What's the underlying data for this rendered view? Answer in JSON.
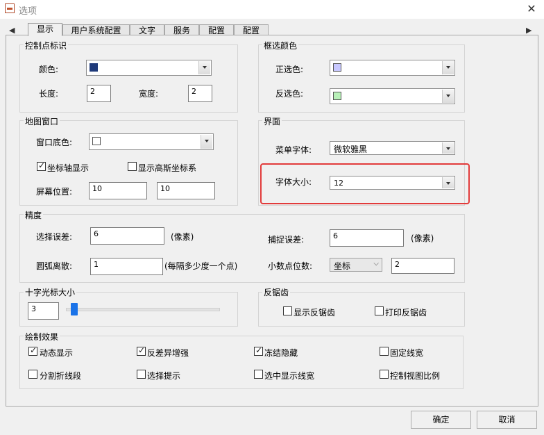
{
  "window": {
    "title": "选项",
    "close_glyph": "✕"
  },
  "tabs": [
    {
      "label": "显示"
    },
    {
      "label": "用户系统配置"
    },
    {
      "label": "文字"
    },
    {
      "label": "服务"
    },
    {
      "label": "配置"
    }
  ],
  "tab_nav": {
    "left": "◀",
    "right": "▶"
  },
  "control_points": {
    "title": "控制点标识",
    "color_label": "颜色:",
    "color_value": "#1f3a7a",
    "length_label": "长度:",
    "length_value": "2",
    "width_label": "宽度:",
    "width_value": "2"
  },
  "selection_color": {
    "title": "框选颜色",
    "forward_label": "正选色:",
    "forward_color": "#c8c8ff",
    "reverse_label": "反选色:",
    "reverse_color": "#b8f0b8"
  },
  "map_window": {
    "title": "地图窗口",
    "bg_label": "窗口底色:",
    "bg_color": "#ffffff",
    "axis_label": "坐标轴显示",
    "axis_checked": true,
    "gauss_label": "显示高斯坐标系",
    "gauss_checked": false,
    "screen_pos_label": "屏幕位置:",
    "screen_x": "10",
    "screen_y": "10"
  },
  "interface": {
    "title": "界面",
    "menu_font_label": "菜单字体:",
    "menu_font_value": "微软雅黑",
    "font_size_label": "字体大小:",
    "font_size_value": "12"
  },
  "precision": {
    "title": "精度",
    "select_tol_label": "选择误差:",
    "select_tol_value": "6",
    "select_tol_unit": "(像素)",
    "snap_tol_label": "捕捉误差:",
    "snap_tol_value": "6",
    "snap_tol_unit": "(像素)",
    "arc_label": "圆弧离散:",
    "arc_value": "1",
    "arc_unit": "(每隔多少度一个点)",
    "decimals_label": "小数点位数:",
    "decimals_mode": "坐标",
    "decimals_value": "2"
  },
  "crosshair": {
    "title": "十字光标大小",
    "value": "3",
    "slider_fraction": 0.03
  },
  "antialias": {
    "title": "反锯齿",
    "display_label": "显示反锯齿",
    "display_checked": false,
    "print_label": "打印反锯齿",
    "print_checked": false
  },
  "draw_effects": {
    "title": "绘制效果",
    "items": [
      {
        "label": "动态显示",
        "checked": true
      },
      {
        "label": "反差异增强",
        "checked": true
      },
      {
        "label": "冻结隐藏",
        "checked": true
      },
      {
        "label": "固定线宽",
        "checked": false
      },
      {
        "label": "分割折线段",
        "checked": false
      },
      {
        "label": "选择提示",
        "checked": false
      },
      {
        "label": "选中显示线宽",
        "checked": false
      },
      {
        "label": "控制视图比例",
        "checked": false
      }
    ]
  },
  "footer": {
    "ok_label": "确定",
    "cancel_label": "取消"
  }
}
